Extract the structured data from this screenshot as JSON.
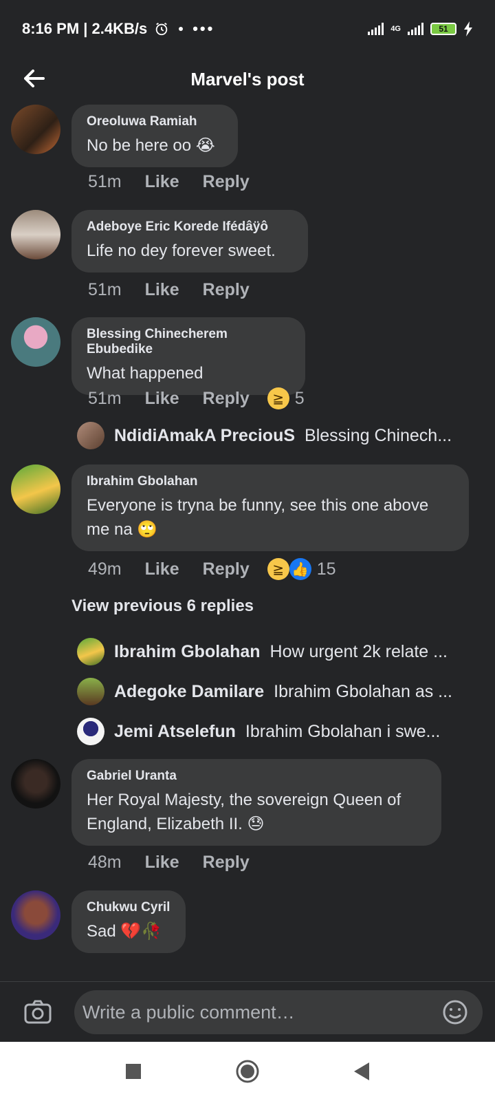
{
  "status_bar": {
    "time_speed": "8:16 PM | 2.4KB/s",
    "network": "4G",
    "battery": "51"
  },
  "header": {
    "title": "Marvel's post"
  },
  "comments": [
    {
      "author": "Oreoluwa Ramiah",
      "text": "No be here oo",
      "emoji": "😭",
      "time": "51m",
      "like": "Like",
      "reply": "Reply"
    },
    {
      "author": "Adeboye Eric Korede Ifédâÿô",
      "text": "Life no dey forever sweet.",
      "time": "51m",
      "like": "Like",
      "reply": "Reply"
    },
    {
      "author": "Blessing Chinecherem Ebubedike",
      "text": "What happened",
      "time": "51m",
      "like": "Like",
      "reply": "Reply",
      "reaction_count": "5"
    },
    {
      "author": "Ibrahim Gbolahan",
      "text": "Everyone is tryna be funny, see this one above me na",
      "emoji": "🙄",
      "time": "49m",
      "like": "Like",
      "reply": "Reply",
      "reaction_count": "15"
    },
    {
      "author": "Gabriel Uranta",
      "text": "Her Royal Majesty, the sovereign Queen of England, Elizabeth II.",
      "emoji": "😓",
      "time": "48m",
      "like": "Like",
      "reply": "Reply"
    },
    {
      "author": "Chukwu Cyril",
      "text": "Sad",
      "emoji": "💔🥀"
    }
  ],
  "replies": [
    {
      "name": "NdidiAmakA PreciouS",
      "text": "Blessing Chinech..."
    },
    {
      "name": "Ibrahim Gbolahan",
      "text": "How urgent 2k relate ..."
    },
    {
      "name": "Adegoke Damilare",
      "text": "Ibrahim Gbolahan as ..."
    },
    {
      "name": "Jemi Atselefun",
      "text": "Ibrahim Gbolahan i swe..."
    }
  ],
  "view_previous": "View previous 6 replies",
  "composer": {
    "placeholder": "Write a public comment…"
  },
  "colors": {
    "background": "#242527",
    "bubble": "#3a3b3c",
    "like_blue": "#1877f2",
    "haha_yellow": "#f7c74a"
  }
}
